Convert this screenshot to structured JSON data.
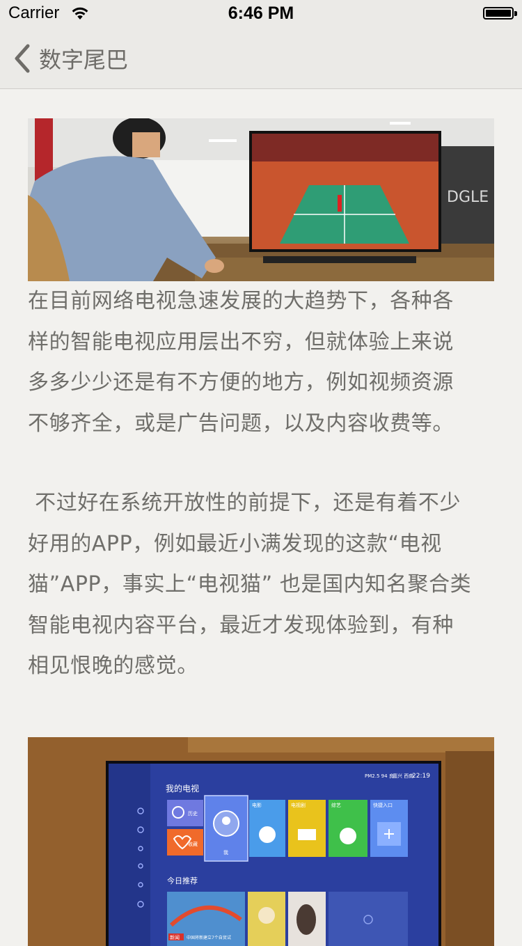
{
  "status_bar": {
    "carrier": "Carrier",
    "time": "6:46 PM",
    "wifi_icon": "wifi-icon",
    "battery_icon": "battery-icon"
  },
  "nav": {
    "back_icon": "chevron-left-icon",
    "title": "数字尾巴"
  },
  "article": {
    "paragraph_1_lines": [
      "在目前网络电视急速发展的大趋势下，各种各",
      "样的智能电视应用层出不穷，但就体验上来说",
      "多多少少还是有不方便的地方，例如视频资源",
      "不够齐全，或是广告问题，以及内容收费等。"
    ],
    "paragraph_2_lines": [
      " 不过好在系统开放性的前提下，还是有着不少",
      "好用的APP，例如最近小满发现的这款“电视",
      "猫”APP，事实上“电视猫” 也是国内知名聚合类",
      "智能电视内容平台，最近才发现体验到，有种",
      "相见恨晚的感觉。"
    ]
  },
  "photo_1": {
    "tv_logos_text": "",
    "wall_text": "DGLE"
  },
  "photo_2": {
    "screen_header": "我的电视",
    "screen_status": "PM2.5 94 良",
    "screen_location": "嘉兴 西南",
    "screen_time": "22:19",
    "tiles": [
      "历史",
      "收藏",
      "我",
      "电影",
      "电视剧",
      "综艺",
      "快捷入口"
    ],
    "section_title": "今日推荐",
    "news_badge": "新闻",
    "news_caption": "中国将新建立7个自贸试"
  },
  "colors": {
    "background": "#f2f1ee",
    "bar_background": "#ebeae7",
    "text": "#6f6e6a",
    "nav_tint": "#6e6c68"
  }
}
